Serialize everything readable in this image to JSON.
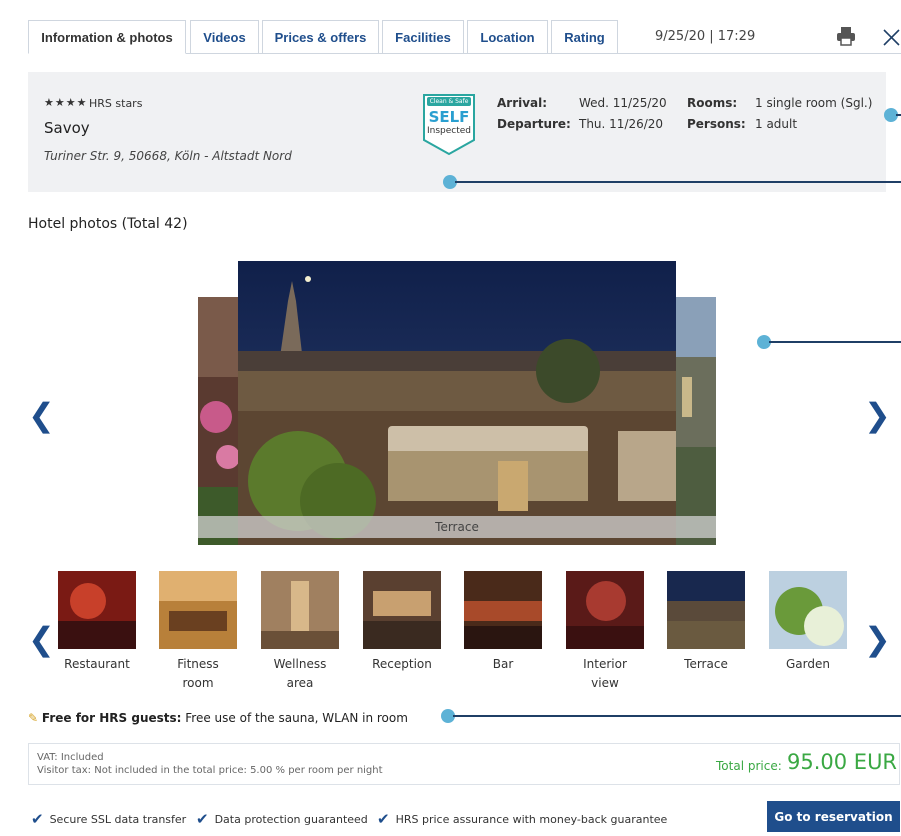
{
  "tabs": [
    {
      "label": "Information & photos",
      "active": true
    },
    {
      "label": "Videos",
      "active": false
    },
    {
      "label": "Prices & offers",
      "active": false
    },
    {
      "label": "Facilities",
      "active": false
    },
    {
      "label": "Location",
      "active": false
    },
    {
      "label": "Rating",
      "active": false
    }
  ],
  "header": {
    "timestamp": "9/25/20 | 17:29",
    "print_icon": "printer-icon",
    "close_icon": "close-icon"
  },
  "hotel": {
    "stars": "★★★★",
    "stars_label": "HRS stars",
    "name": "Savoy",
    "address": "Turiner Str. 9, 50668, Köln - Altstadt Nord",
    "badge": {
      "top": "Clean & Safe",
      "main": "SELF",
      "sub": "Inspected"
    }
  },
  "booking": {
    "arrival_label": "Arrival:",
    "arrival_value": "Wed. 11/25/20",
    "departure_label": "Departure:",
    "departure_value": "Thu. 11/26/20",
    "rooms_label": "Rooms:",
    "rooms_value": "1 single room (Sgl.)",
    "persons_label": "Persons:",
    "persons_value": "1 adult"
  },
  "gallery": {
    "title": "Hotel photos (Total 42)",
    "caption": "Terrace",
    "prev_icon": "chevron-left-icon",
    "next_icon": "chevron-right-icon"
  },
  "thumbnails": [
    {
      "label": "Restaurant"
    },
    {
      "label": "Fitness room"
    },
    {
      "label": "Wellness area"
    },
    {
      "label": "Reception"
    },
    {
      "label": "Bar"
    },
    {
      "label": "Interior view"
    },
    {
      "label": "Terrace"
    },
    {
      "label": "Garden"
    }
  ],
  "free": {
    "label": "Free for HRS guests:",
    "text": "Free use of the sauna, WLAN in room"
  },
  "price": {
    "vat": "VAT: Included",
    "tax_label": "Visitor tax: Not included in the total price:",
    "tax_value": "5.00 % per room per night",
    "total_label": "Total price:",
    "total_value": "95.00 EUR"
  },
  "assurances": [
    "Secure SSL data transfer",
    "Data protection guaranteed",
    "HRS price assurance with money-back guarantee"
  ],
  "cta": "Go to reservation",
  "colors": {
    "accent": "#1f4e8c",
    "price": "#3aa843",
    "marker": "#5db2d6"
  }
}
